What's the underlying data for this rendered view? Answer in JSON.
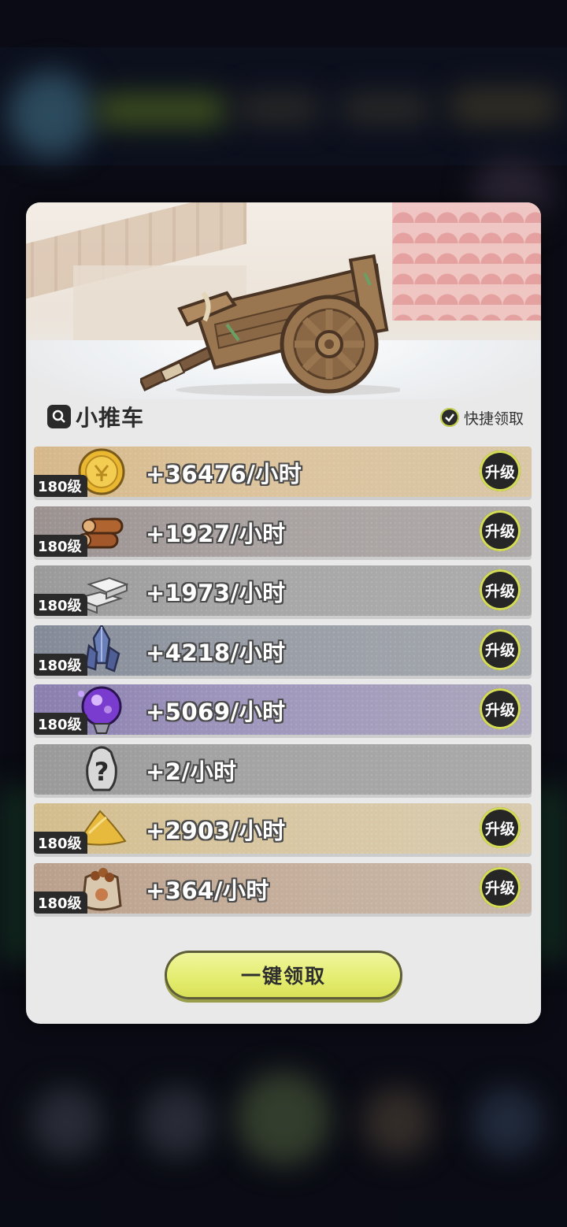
{
  "panel": {
    "title": "小推车",
    "title_icon": "search-icon",
    "quick_claim_label": "快捷领取"
  },
  "rows": [
    {
      "level": "180级",
      "rate": "+36476/小时",
      "upgrade": "升级",
      "icon": "gold-coin-icon"
    },
    {
      "level": "180级",
      "rate": "+1927/小时",
      "upgrade": "升级",
      "icon": "wood-logs-icon"
    },
    {
      "level": "180级",
      "rate": "+1973/小时",
      "upgrade": "升级",
      "icon": "stone-bricks-icon"
    },
    {
      "level": "180级",
      "rate": "+4218/小时",
      "upgrade": "升级",
      "icon": "crystal-icon"
    },
    {
      "level": "180级",
      "rate": "+5069/小时",
      "upgrade": "升级",
      "icon": "purple-orb-icon"
    },
    {
      "level": "",
      "rate": "+2/小时",
      "upgrade": "",
      "icon": "mystery-item-icon"
    },
    {
      "level": "180级",
      "rate": "+2903/小时",
      "upgrade": "升级",
      "icon": "sand-pile-icon"
    },
    {
      "level": "180级",
      "rate": "+364/小时",
      "upgrade": "升级",
      "icon": "food-sack-icon"
    }
  ],
  "claim_all_label": "一键领取",
  "colors": {
    "accent": "#e4ec6e",
    "panel_bg": "#e9e9ea",
    "badge_bg": "#2a2a2a"
  }
}
